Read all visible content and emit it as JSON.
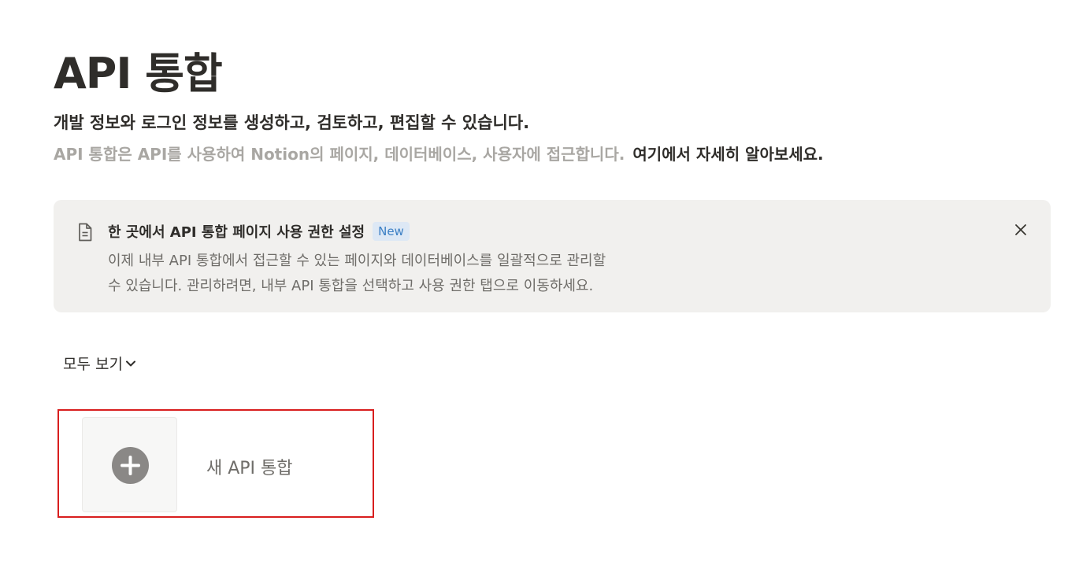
{
  "page": {
    "title": "API 통합",
    "subtitle": "개발 정보와 로그인 정보를 생성하고, 검토하고, 편집할 수 있습니다.",
    "description": "API 통합은 API를 사용하여 Notion의 페이지, 데이터베이스, 사용자에 접근합니다.",
    "learn_more": "여기에서 자세히 알아보세요."
  },
  "banner": {
    "icon": "document-icon",
    "title": "한 곳에서 API 통합 페이지 사용 권한 설정",
    "badge": "New",
    "text_line1": "이제 내부 API 통합에서 접근할 수 있는 페이지와 데이터베이스를 일괄적으로 관리할",
    "text_line2": "수 있습니다. 관리하려면, 내부 API 통합을 선택하고 사용 권한 탭으로 이동하세요.",
    "close_icon": "close-icon"
  },
  "filter": {
    "label": "모두 보기",
    "icon": "chevron-down-icon"
  },
  "new_integration": {
    "label": "새 API 통합",
    "icon": "plus-circle-icon"
  },
  "colors": {
    "highlight_border": "#d81e1e",
    "badge_text": "#3b7fc4",
    "badge_bg": "#dde8f5",
    "banner_bg": "#f1f0ee"
  }
}
